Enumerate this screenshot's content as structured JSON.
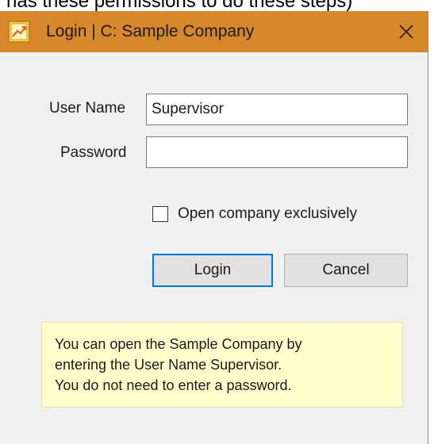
{
  "background_caption": "nas these permissions to do these steps)",
  "window": {
    "title": "Login | C: Sample Company",
    "titlebar_color": "#d7882a",
    "app_icon": "accounting-app-icon",
    "close_icon": "close-icon"
  },
  "form": {
    "username_label": "User Name",
    "username_value": "Supervisor",
    "password_label": "Password",
    "password_value": "",
    "exclusive_checkbox_label": "Open company exclusively",
    "exclusive_checked": false
  },
  "buttons": {
    "login_label": "Login",
    "cancel_label": "Cancel"
  },
  "info": {
    "lines": [
      "You can open the Sample Company by",
      "entering the User Name Supervisor.",
      "You do not need to enter a password."
    ],
    "background_color": "#ffffcc"
  }
}
